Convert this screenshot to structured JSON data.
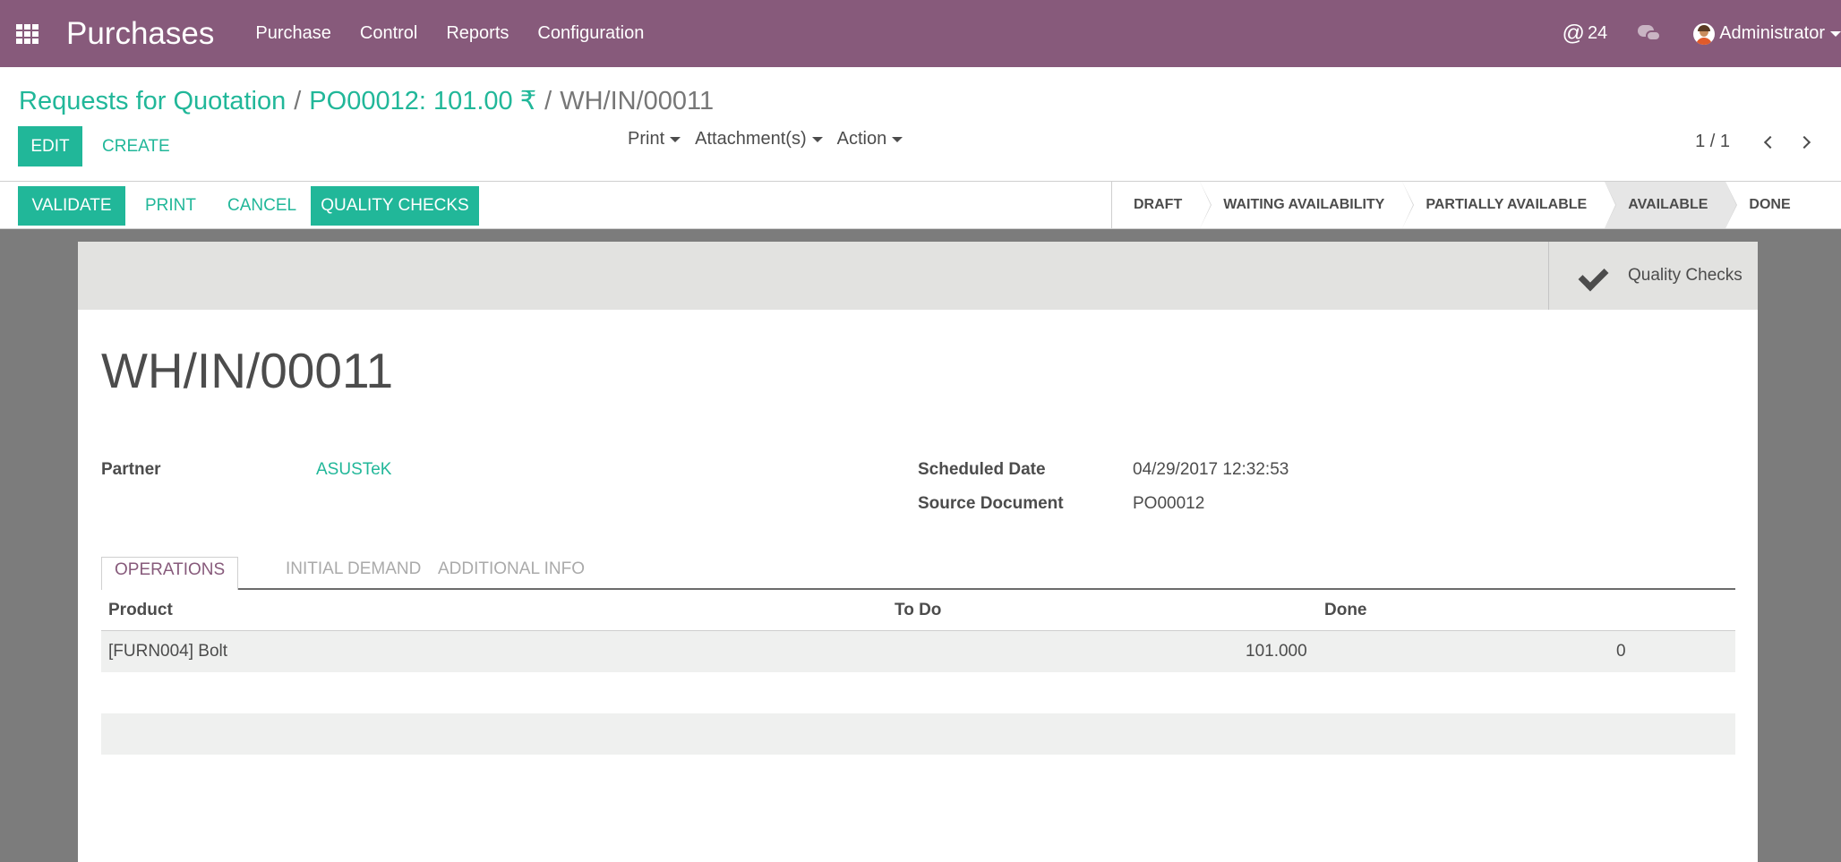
{
  "navbar": {
    "brand": "Purchases",
    "menu": [
      "Purchase",
      "Control",
      "Reports",
      "Configuration"
    ],
    "mentions": "24",
    "user": "Administrator"
  },
  "breadcrumb": {
    "root": "Requests for Quotation",
    "parent": "PO00012: 101.00 ₹",
    "current": "WH/IN/00011",
    "separator": "/"
  },
  "toolbar": {
    "edit_label": "EDIT",
    "create_label": "CREATE",
    "print_label": "Print",
    "attachments_label": "Attachment(s)",
    "action_label": "Action"
  },
  "pager": {
    "value": "1 / 1"
  },
  "header_buttons": {
    "validate": "VALIDATE",
    "print": "PRINT",
    "cancel": "CANCEL",
    "quality_checks": "QUALITY CHECKS"
  },
  "statusbar": {
    "stages": [
      "DRAFT",
      "WAITING AVAILABILITY",
      "PARTIALLY AVAILABLE",
      "AVAILABLE",
      "DONE"
    ],
    "active": "AVAILABLE"
  },
  "smart_button": {
    "label": "Quality Checks"
  },
  "record": {
    "name": "WH/IN/00011",
    "partner_label": "Partner",
    "partner_value": "ASUSTeK",
    "scheduled_date_label": "Scheduled Date",
    "scheduled_date_value": "04/29/2017 12:32:53",
    "source_document_label": "Source Document",
    "source_document_value": "PO00012"
  },
  "tabs": [
    "OPERATIONS",
    "INITIAL DEMAND",
    "ADDITIONAL INFO"
  ],
  "operations": {
    "columns": [
      "Product",
      "To Do",
      "Done"
    ],
    "rows": [
      {
        "product": "[FURN004] Bolt",
        "todo": "101.000",
        "done": "0"
      }
    ]
  },
  "colors": {
    "brand": "#875a7b",
    "accent": "#21b799",
    "text": "#4c4c4c"
  }
}
